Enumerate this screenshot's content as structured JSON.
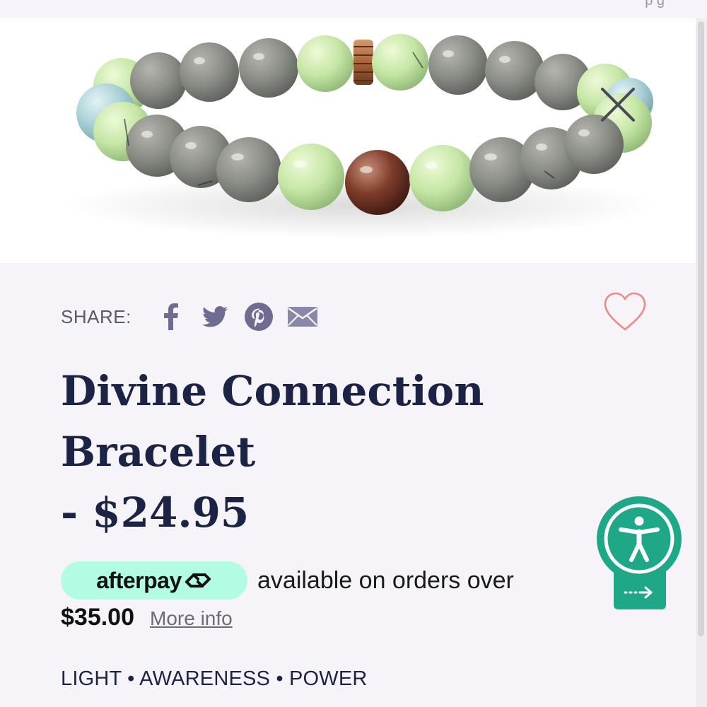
{
  "page": {
    "top_strip_fragment": "p   g",
    "background": "#f6f4f8"
  },
  "product_image": {
    "description_icon": "bracelet-photo",
    "close_icon": "close-icon"
  },
  "share": {
    "label": "SHARE:",
    "icons": [
      "facebook-icon",
      "twitter-icon",
      "pinterest-icon",
      "email-icon"
    ],
    "icon_color": "#6f6c92"
  },
  "favorite": {
    "icon": "heart-icon",
    "color": "#ee8a86"
  },
  "product": {
    "title_line1": "Divine Connection",
    "title_line2": "Bracelet",
    "price_line": "- $24.95",
    "title_color": "#1c2446"
  },
  "afterpay": {
    "brand": "afterpay",
    "badge_color": "#b2fce4",
    "text": "available on orders over",
    "threshold": "$35.00",
    "link": "More info"
  },
  "tagline": "LIGHT • AWARENESS • POWER",
  "accessibility_widget": {
    "icon": "accessibility-icon",
    "arrow_icon": "arrow-right-icon",
    "color": "#1fa888"
  }
}
